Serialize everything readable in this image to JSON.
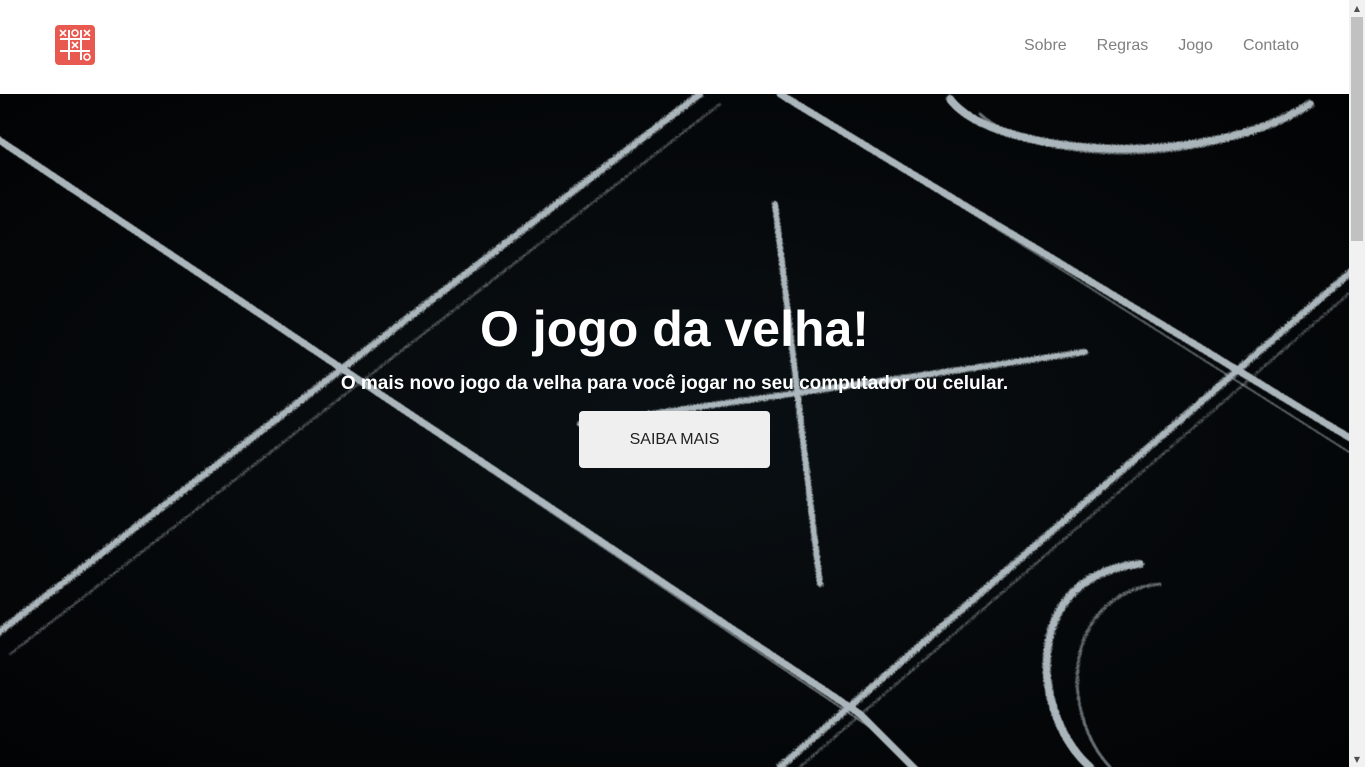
{
  "header": {
    "logo_icon": "tic-tac-toe-logo-icon",
    "logo_color": "#e85a4f",
    "nav": [
      {
        "label": "Sobre"
      },
      {
        "label": "Regras"
      },
      {
        "label": "Jogo"
      },
      {
        "label": "Contato"
      }
    ]
  },
  "hero": {
    "background": "chalk tic-tac-toe board on dark background",
    "title": "O jogo da velha!",
    "subtitle": "O mais novo jogo da velha para você jogar no seu computador ou celular.",
    "cta_label": "SAIBA MAIS"
  },
  "scrollbar": {
    "up_icon": "scroll-up-arrow-icon",
    "down_icon": "scroll-down-arrow-icon"
  }
}
